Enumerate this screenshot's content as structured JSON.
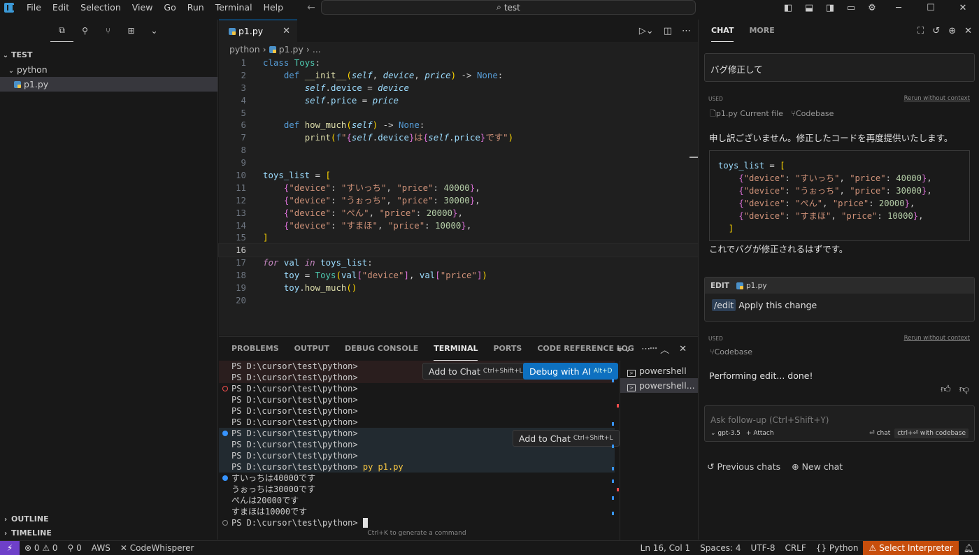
{
  "titlebar": {
    "menus": [
      "File",
      "Edit",
      "Selection",
      "View",
      "Go",
      "Run",
      "Terminal",
      "Help"
    ],
    "search": "test"
  },
  "sidebar": {
    "folder": "TEST",
    "items": [
      {
        "label": "python",
        "type": "folder"
      },
      {
        "label": "p1.py",
        "type": "file"
      }
    ],
    "outline": "OUTLINE",
    "timeline": "TIMELINE"
  },
  "editor": {
    "tab": "p1.py",
    "breadcrumb": [
      "python",
      "p1.py",
      "..."
    ],
    "current_line": 16
  },
  "panel": {
    "tabs": [
      "PROBLEMS",
      "OUTPUT",
      "DEBUG CONSOLE",
      "TERMINAL",
      "PORTS",
      "CODE REFERENCE LOG"
    ],
    "active_tab": "TERMINAL",
    "terminal_lines": [
      "PS D:\\cursor\\test\\python>",
      "PS D:\\cursor\\test\\python>",
      "PS D:\\cursor\\test\\python>",
      "PS D:\\cursor\\test\\python>",
      "PS D:\\cursor\\test\\python>",
      "PS D:\\cursor\\test\\python>",
      "PS D:\\cursor\\test\\python>",
      "PS D:\\cursor\\test\\python>",
      "PS D:\\cursor\\test\\python>",
      "PS D:\\cursor\\test\\python>",
      "すいっちは40000です",
      "うぉっちは30000です",
      "ぺんは20000です",
      "すまほは10000です",
      "PS D:\\cursor\\test\\python>"
    ],
    "command_line_prompt": "PS D:\\cursor\\test\\python>",
    "command": "py p1.py",
    "footer_hint": "Ctrl+K to generate a command",
    "add_to_chat": "Add to Chat",
    "add_to_chat_shortcut": "Ctrl+Shift+L",
    "debug_ai": "Debug with AI",
    "debug_ai_shortcut": "Alt+D",
    "terminals": [
      "powershell",
      "powershell..."
    ]
  },
  "chat": {
    "tabs": [
      "CHAT",
      "MORE"
    ],
    "user_message": "バグ修正して",
    "used_label": "USED",
    "rerun": "Rerun without context",
    "context_file": "p1.py Current file",
    "context_codebase": "Codebase",
    "reply_intro": "申し訳ございません。修正したコードを再度提供いたします。",
    "reply_outro": "これでバグが修正されるはずです。",
    "edit_label": "EDIT",
    "edit_file": "p1.py",
    "edit_cmd": "/edit",
    "edit_text": "Apply this change",
    "second_context": "Codebase",
    "performing": "Performing edit... done!",
    "followup_placeholder": "Ask follow-up (Ctrl+Shift+Y)",
    "model": "gpt-3.5",
    "attach": "Attach",
    "chat_btn": "chat",
    "codebase_btn": "ctrl+⏎ with codebase",
    "previous_chats": "Previous chats",
    "new_chat": "New chat"
  },
  "statusbar": {
    "errors": "0",
    "warnings": "0",
    "ports": "0",
    "aws": "AWS",
    "codewhisperer": "CodeWhisperer",
    "position": "Ln 16, Col 1",
    "spaces": "Spaces: 4",
    "encoding": "UTF-8",
    "eol": "CRLF",
    "language": "Python",
    "interpreter": "Select Interpreter"
  },
  "colors": {
    "accent": "#0078d4",
    "warning_bg": "#c74e0c",
    "remote": "#6e40c9"
  }
}
